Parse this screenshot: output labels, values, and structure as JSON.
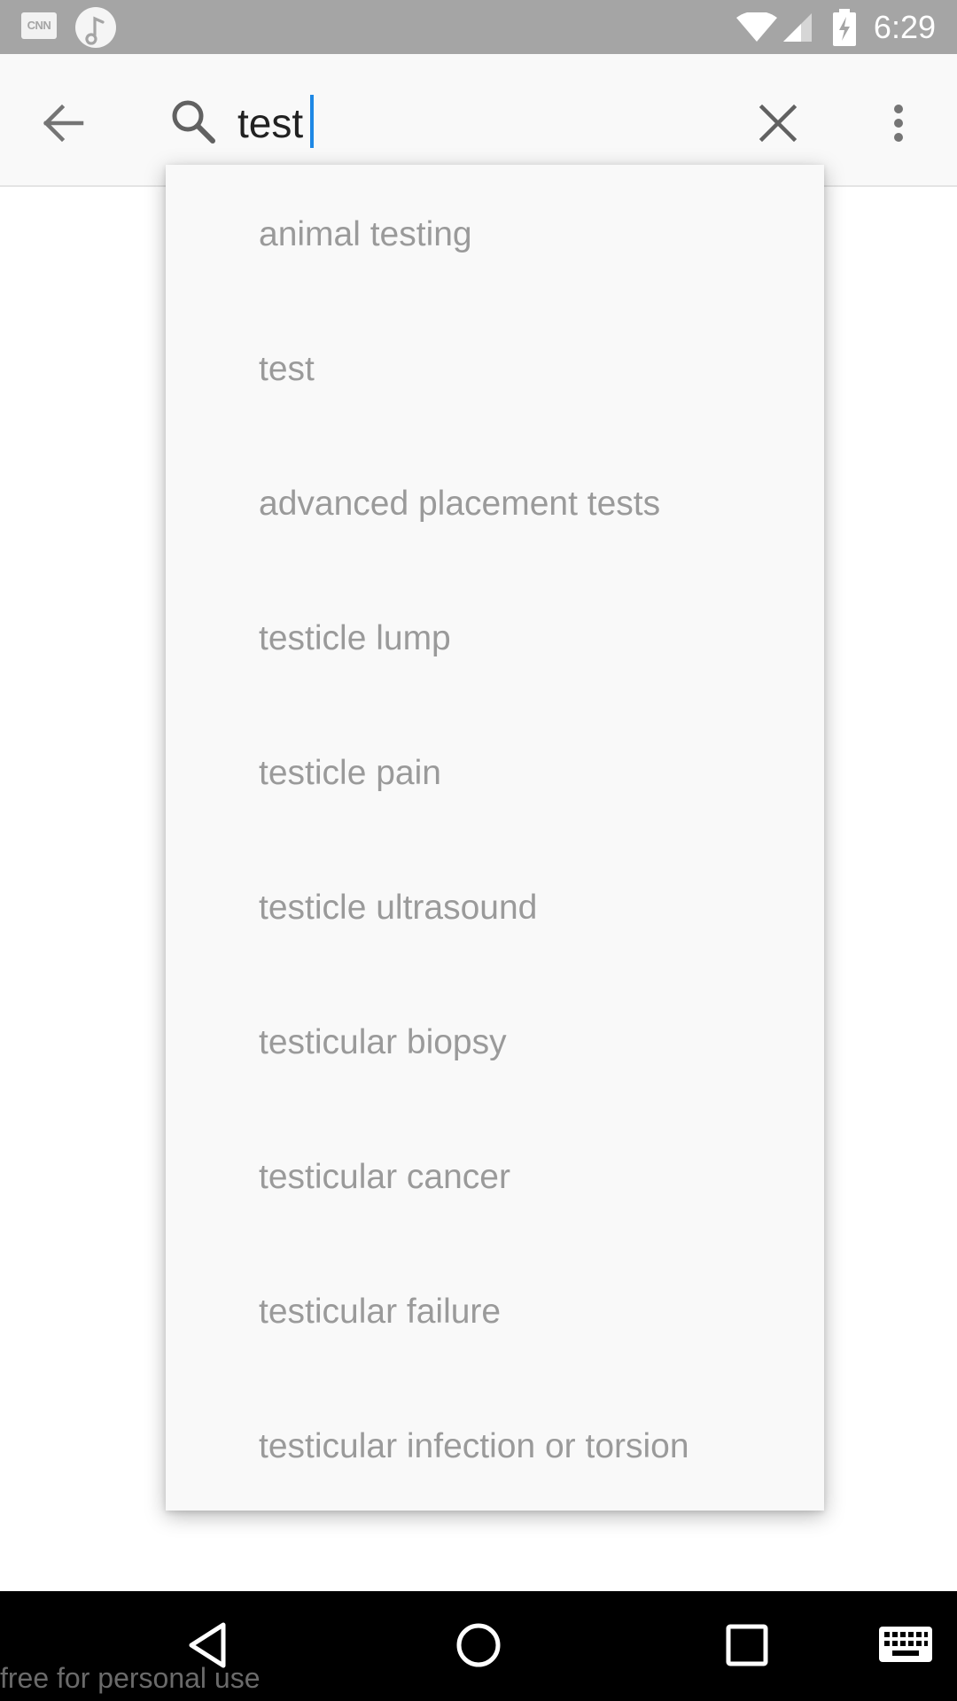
{
  "status_bar": {
    "time": "6:29",
    "notification_icons": [
      "cnn-icon",
      "music-icon"
    ],
    "cnn_label": "CNN",
    "system_icons": [
      "wifi-icon",
      "signal-icon",
      "battery-charging-icon"
    ]
  },
  "app_bar": {
    "back_icon": "arrow-left-icon",
    "search_icon": "search-icon",
    "query": "test",
    "clear_icon": "close-icon",
    "overflow_icon": "more-vert-icon"
  },
  "suggestions": [
    "animal testing",
    "test",
    "advanced placement tests",
    "testicle lump",
    "testicle pain",
    "testicle ultrasound",
    "testicular biopsy",
    "testicular cancer",
    "testicular failure",
    "testicular infection or torsion"
  ],
  "nav_bar": {
    "icons": [
      "nav-back-icon",
      "nav-home-icon",
      "nav-recents-icon",
      "keyboard-icon"
    ]
  },
  "watermark": "free for personal use",
  "colors": {
    "status_bar": "#a5a5a5",
    "app_bar": "#f9f9f9",
    "cursor": "#1e88e5",
    "suggestion_text": "#9a9a9a",
    "nav_bar": "#000000"
  }
}
